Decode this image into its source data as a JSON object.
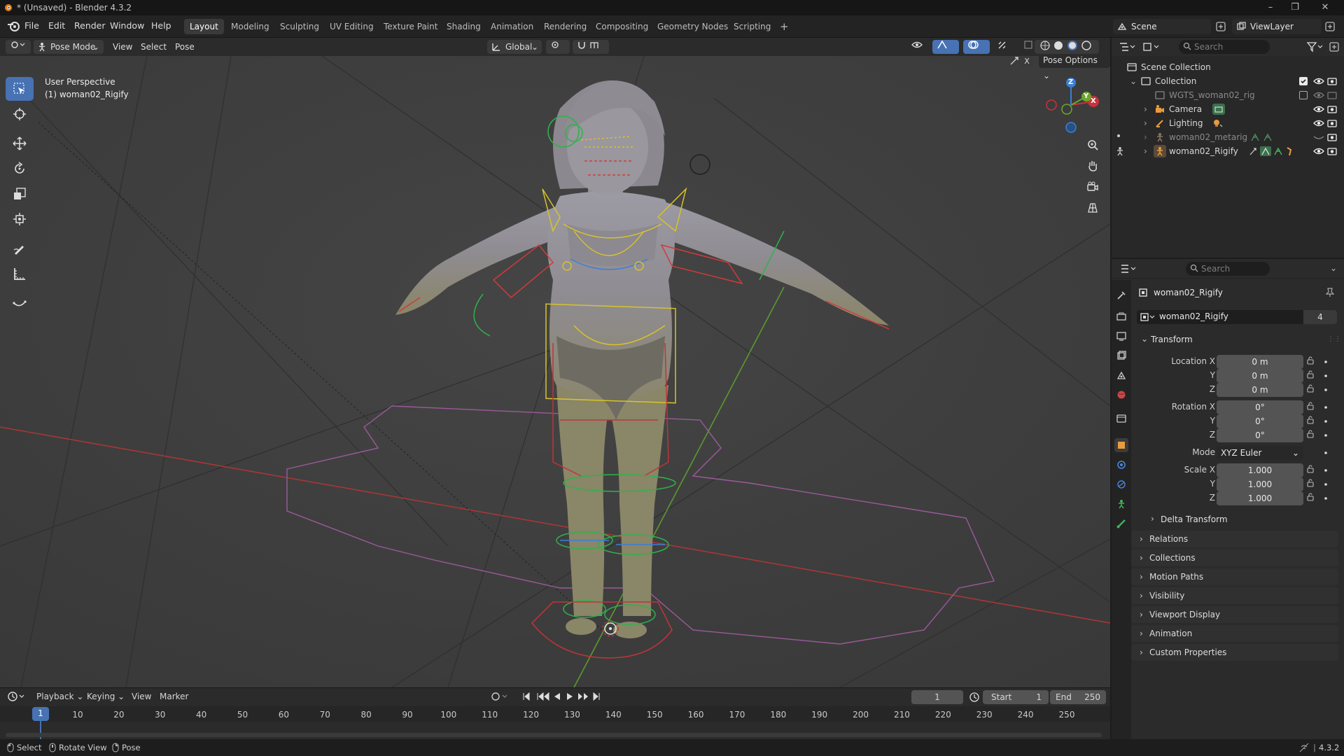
{
  "window": {
    "title": "* (Unsaved) - Blender 4.3.2"
  },
  "menu": {
    "items": [
      "File",
      "Edit",
      "Render",
      "Window",
      "Help"
    ]
  },
  "workspaces": {
    "tabs": [
      "Layout",
      "Modeling",
      "Sculpting",
      "UV Editing",
      "Texture Paint",
      "Shading",
      "Animation",
      "Rendering",
      "Compositing",
      "Geometry Nodes",
      "Scripting"
    ],
    "active": "Layout"
  },
  "scene": {
    "name": "Scene",
    "view_layer": "ViewLayer"
  },
  "viewport_header": {
    "mode": "Pose Mode",
    "menus": [
      "View",
      "Select",
      "Pose"
    ],
    "transform_orientation": "Global",
    "pose_options": "Pose Options",
    "mirror_x": "X"
  },
  "viewport": {
    "perspective_label": "User Perspective",
    "object_label": "(1) woman02_Rigify",
    "gizmo_axes": [
      "X",
      "Y",
      "Z"
    ]
  },
  "outliner": {
    "search_placeholder": "Search",
    "root": "Scene Collection",
    "collection": "Collection",
    "items": [
      {
        "name": "WGTS_woman02_rig",
        "dim": true
      },
      {
        "name": "Camera",
        "dim": false
      },
      {
        "name": "Lighting",
        "dim": false
      },
      {
        "name": "woman02_metarig",
        "dim": true
      },
      {
        "name": "woman02_Rigify",
        "dim": false
      }
    ]
  },
  "properties": {
    "search_placeholder": "Search",
    "object_name": "woman02_Rigify",
    "datablock_name": "woman02_Rigify",
    "user_count": "4",
    "transform_title": "Transform",
    "location": {
      "label": "Location X",
      "x": "0 m",
      "y": "0 m",
      "z": "0 m"
    },
    "rotation": {
      "label": "Rotation X",
      "x": "0°",
      "y": "0°",
      "z": "0°"
    },
    "rotation_mode": {
      "label": "Mode",
      "value": "XYZ Euler"
    },
    "scale": {
      "label": "Scale X",
      "x": "1.000",
      "y": "1.000",
      "z": "1.000"
    },
    "axis_labels": {
      "y": "Y",
      "z": "Z"
    },
    "delta_transform": "Delta Transform",
    "panels": [
      "Relations",
      "Collections",
      "Motion Paths",
      "Visibility",
      "Viewport Display",
      "Animation",
      "Custom Properties"
    ]
  },
  "timeline": {
    "menus": [
      "Playback",
      "Keying",
      "View",
      "Marker"
    ],
    "current_frame": "1",
    "start_label": "Start",
    "start": "1",
    "end_label": "End",
    "end": "250",
    "ruler": [
      "1",
      "10",
      "20",
      "30",
      "40",
      "50",
      "60",
      "70",
      "80",
      "90",
      "100",
      "110",
      "120",
      "130",
      "140",
      "150",
      "160",
      "170",
      "180",
      "190",
      "200",
      "210",
      "220",
      "230",
      "240",
      "250"
    ]
  },
  "statusbar": {
    "hints": [
      "Select",
      "Rotate View",
      "Pose"
    ],
    "version": "4.3.2"
  },
  "colors": {
    "accent": "#4772b3",
    "viewport_bg": "#3d3d3d",
    "x_axis": "#c8323c",
    "y_axis": "#6ca62f",
    "z_axis": "#3b7fd6",
    "bone_yellow": "#e6d22e",
    "bone_red": "#d23a3a",
    "bone_green": "#2fb24a"
  }
}
